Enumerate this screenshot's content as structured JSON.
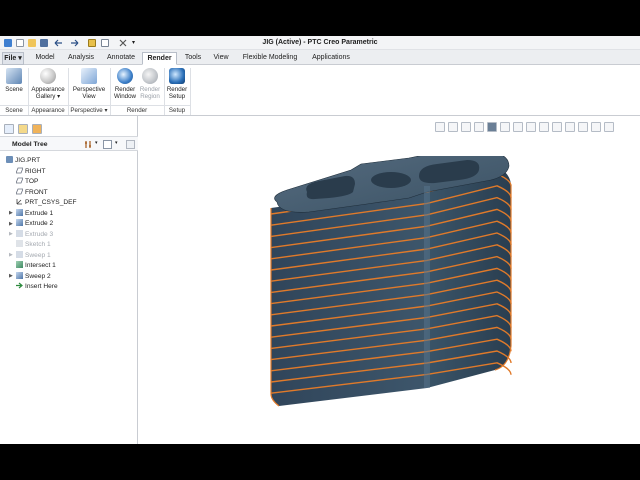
{
  "window": {
    "title": "JIG (Active) - PTC Creo Parametric"
  },
  "quick_access": {
    "icons": [
      "app-icon",
      "new-icon",
      "open-icon",
      "save-icon",
      "undo-icon",
      "redo-icon",
      "regenerate-icon",
      "close-window-icon",
      "customize-icon"
    ]
  },
  "tabs": [
    {
      "label": "File",
      "active": false
    },
    {
      "label": "Model",
      "active": false
    },
    {
      "label": "Analysis",
      "active": false
    },
    {
      "label": "Annotate",
      "active": false
    },
    {
      "label": "Render",
      "active": true
    },
    {
      "label": "Tools",
      "active": false
    },
    {
      "label": "View",
      "active": false
    },
    {
      "label": "Flexible Modeling",
      "active": false
    },
    {
      "label": "Applications",
      "active": false
    }
  ],
  "ribbon": {
    "scene": {
      "label": "Scene"
    },
    "appearance_gallery": {
      "label1": "Appearance",
      "label2": "Gallery"
    },
    "perspective_view": {
      "label1": "Perspective",
      "label2": "View"
    },
    "render_window": {
      "label1": "Render",
      "label2": "Window"
    },
    "render_region": {
      "label1": "Render",
      "label2": "Region"
    },
    "render_setup": {
      "label1": "Render",
      "label2": "Setup"
    },
    "groups": {
      "scene": "Scene",
      "appearance": "Appearance",
      "perspective": "Perspective",
      "render": "Render",
      "setup": "Setup"
    }
  },
  "model_tree": {
    "header": "Model Tree",
    "items": [
      {
        "label": "JIG.PRT",
        "icon": "part-icon",
        "state": "normal"
      },
      {
        "label": "RIGHT",
        "icon": "datum-plane-icon",
        "state": "normal"
      },
      {
        "label": "TOP",
        "icon": "datum-plane-icon",
        "state": "normal"
      },
      {
        "label": "FRONT",
        "icon": "datum-plane-icon",
        "state": "normal"
      },
      {
        "label": "PRT_CSYS_DEF",
        "icon": "csys-icon",
        "state": "normal"
      },
      {
        "label": "Extrude 1",
        "icon": "extrude-icon",
        "state": "normal"
      },
      {
        "label": "Extrude 2",
        "icon": "extrude-icon",
        "state": "normal"
      },
      {
        "label": "Extrude 3",
        "icon": "extrude-icon",
        "state": "suppressed"
      },
      {
        "label": "Sketch 1",
        "icon": "sketch-icon",
        "state": "suppressed"
      },
      {
        "label": "Sweep 1",
        "icon": "sweep-icon",
        "state": "suppressed"
      },
      {
        "label": "Intersect 1",
        "icon": "intersect-icon",
        "state": "normal"
      },
      {
        "label": "Sweep 2",
        "icon": "sweep-icon",
        "state": "normal"
      },
      {
        "label": "Insert Here",
        "icon": "insert-arrow-icon",
        "state": "normal"
      }
    ]
  },
  "colors": {
    "model_body": "#3b5264",
    "model_edge": "#e07a2a",
    "background": "#ffffff",
    "accent": "#2f6db5"
  }
}
